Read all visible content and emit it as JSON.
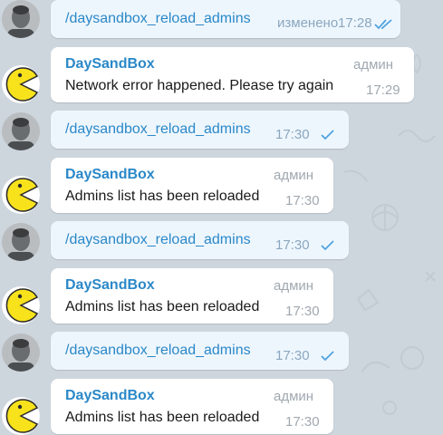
{
  "messages": [
    {
      "command": "/daysandbox_reload_admins",
      "edited_label": "изменено",
      "time": "17:28",
      "status": "read"
    },
    {
      "sender": "DaySandBox",
      "role": "админ",
      "text": "Network error happened. Please try again",
      "time": "17:29"
    },
    {
      "command": "/daysandbox_reload_admins",
      "time": "17:30",
      "status": "sent"
    },
    {
      "sender": "DaySandBox",
      "role": "админ",
      "text": "Admins list has been reloaded",
      "time": "17:30"
    },
    {
      "command": "/daysandbox_reload_admins",
      "time": "17:30",
      "status": "sent"
    },
    {
      "sender": "DaySandBox",
      "role": "админ",
      "text": "Admins list has been reloaded",
      "time": "17:30"
    },
    {
      "command": "/daysandbox_reload_admins",
      "time": "17:30",
      "status": "sent"
    },
    {
      "sender": "DaySandBox",
      "role": "админ",
      "text": "Admins list has been reloaded",
      "time": "17:30"
    }
  ],
  "colors": {
    "background": "#cdd5dd",
    "outgoing_bubble": "#eef6fd",
    "incoming_bubble": "#ffffff",
    "link_blue": "#2a88c8",
    "check_blue": "#4fa3e0",
    "bot_avatar_yellow": "#f7e21c"
  },
  "icons": {
    "user_avatar": "user-photo-avatar",
    "bot_avatar": "pacman-avatar-icon",
    "sent": "single-check-icon",
    "read": "double-check-icon"
  }
}
